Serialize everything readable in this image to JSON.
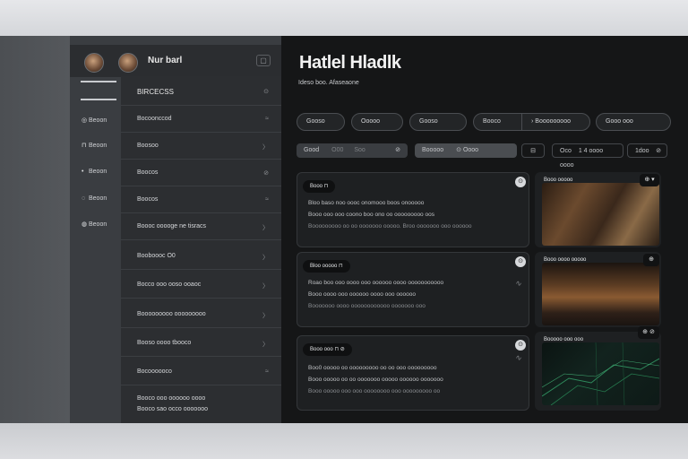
{
  "sidebar": {
    "user_name": "Nur barl",
    "top_button": "▢",
    "rail_items": [
      {
        "icon": "◎",
        "label": "Beoon"
      },
      {
        "icon": "⊓",
        "label": "Beoon"
      },
      {
        "icon": "•",
        "label": "Beoon"
      },
      {
        "icon": "◌",
        "label": "Beoon"
      },
      {
        "icon": "◍",
        "label": "Beoon"
      }
    ],
    "panel_header": {
      "label": "BIRCECSS",
      "meta": "⊙"
    },
    "panel_rows": [
      {
        "label": "Bocoonccod",
        "meta": "≈"
      },
      {
        "label": "Boosoo",
        "meta": "〉"
      },
      {
        "label": "Boocos",
        "meta": "⊘"
      },
      {
        "label": "Boocos",
        "meta": "≈"
      },
      {
        "label": "Boooc ooooge ne tisracs",
        "meta": "〉"
      },
      {
        "label": "Booboooc O0",
        "meta": "〉"
      },
      {
        "label": "Bocco ooo ooso ooaoc",
        "meta": "〉"
      },
      {
        "label": "Booooooooo ooooooooo",
        "meta": "〉"
      },
      {
        "label": "Booso oooo tbooco",
        "meta": "〉"
      },
      {
        "label": "Bocoooooco",
        "meta": "≈"
      },
      {
        "label": "Booco ooo oooooo oooo",
        "meta": ""
      },
      {
        "label": "Booco sao occo ooooooo",
        "meta": ""
      }
    ]
  },
  "main": {
    "title": "Hatlel Hladlk",
    "subtitle": "Ideso boo. Afaseaone",
    "chips": [
      "Gooso",
      "Ooooo",
      "Gooso",
      "Booco",
      "Booooooooo",
      "Gooo ooo"
    ],
    "filters": [
      {
        "label": "Good",
        "extra": "O00",
        "tail": "Soo",
        "icon": "⊘"
      },
      {
        "label": "Booooo",
        "extra": "⊙ Oooo",
        "tail": "",
        "icon": ""
      },
      {
        "label": "",
        "extra": "",
        "tail": "",
        "icon": "⊟"
      },
      {
        "label": "Oco",
        "extra": "1 4 oooo oooo",
        "tail": "",
        "icon": ""
      },
      {
        "label": "1doo",
        "extra": "",
        "tail": "",
        "icon": "⊘"
      }
    ]
  },
  "feed": [
    {
      "tag": "Booo  ⊓",
      "lines": [
        "Bloo baso noo oooc onomooo boos onooooo",
        "Booo ooo ooo coono boo ono oo ooooooooo oos",
        "Booooooooo oo oo ooooooo ooooo.  Broo ooooooo  ooo oooooo"
      ],
      "thumb_label": "Booo  ooooo",
      "thumb_btn": "⊕  ▾"
    },
    {
      "tag": "Bloo  ooooo  ⊓",
      "lines": [
        "Roao boo ooo oooo ooo oooooo oooo ooooooooooo",
        "Booo oooo  ooo oooooo  oooo  ooo oooooo",
        "Booooooo  oooo oooooooooooo  ooooooo  ooo"
      ],
      "thumb_label": "Booo oooo  ooooo",
      "thumb_btn": "⊕"
    },
    {
      "tag": "Booo  ooo  ⊓  ⊘",
      "lines": [
        "Boo0 ooooo oo ooooooooo oo oo ooo ooooooooo",
        "Booo ooooo oo oo ooooooo ooooo  oooooo ooooooo",
        "Booo ooooo ooo ooo oooooooo ooo ooooooooo oo"
      ],
      "thumb_label": "Booooo  ooo  ooo",
      "thumb_btn": "⊕  ⊘"
    }
  ],
  "colors": {
    "background": "#151617",
    "sidebar": "#3a3d41",
    "panel": "#2c2e31",
    "accent": "#d7d9dc"
  }
}
